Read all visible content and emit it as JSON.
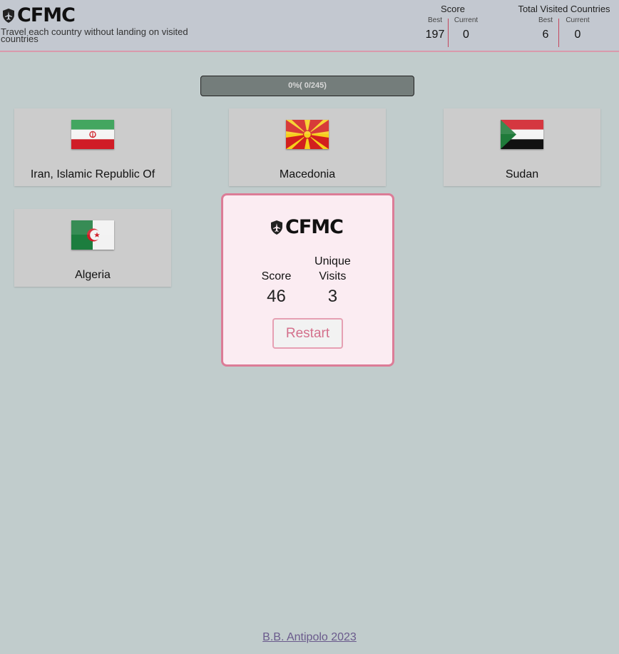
{
  "header": {
    "title": "CFMC",
    "tagline": "Travel each country without landing on visited countries",
    "score": {
      "title": "Score",
      "best_label": "Best",
      "current_label": "Current",
      "best": "197",
      "current": "0"
    },
    "visited": {
      "title": "Total Visited Countries",
      "best_label": "Best",
      "current_label": "Current",
      "best": "6",
      "current": "0"
    }
  },
  "progress": {
    "text": "0%( 0/245)",
    "percent": 0
  },
  "countries": [
    {
      "name": "Iran, Islamic Republic Of",
      "flag": "iran-flag"
    },
    {
      "name": "Macedonia",
      "flag": "macedonia-flag"
    },
    {
      "name": "Sudan",
      "flag": "sudan-flag"
    },
    {
      "name": "Algeria",
      "flag": "algeria-flag"
    }
  ],
  "modal": {
    "title": "CFMC",
    "score_label": "Score",
    "score_value": "46",
    "visits_label": "Unique Visits",
    "visits_value": "3",
    "restart_label": "Restart"
  },
  "footer": {
    "credit": "B.B. Antipolo 2023"
  },
  "colors": {
    "accent": "#dc7c97",
    "modal_bg": "#fbecf2",
    "page_bg": "#c1cccc",
    "header_bg": "#c3c8d0"
  }
}
